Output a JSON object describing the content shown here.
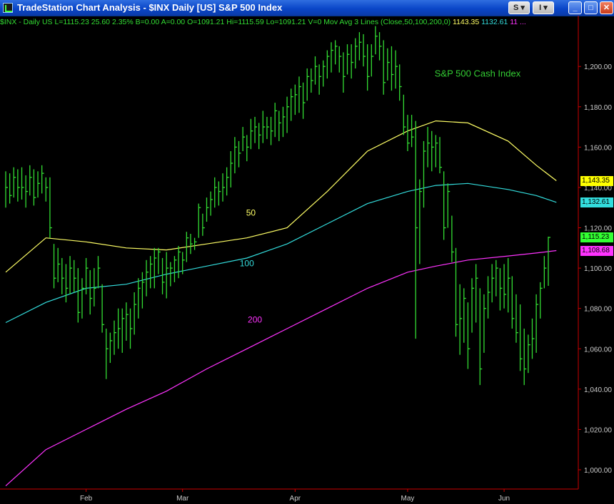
{
  "window": {
    "title": "TradeStation Chart Analysis - $INX Daily [US] S&P 500 Index",
    "buttons": [
      {
        "name": "symbol-link-button",
        "label": "S"
      },
      {
        "name": "interval-link-button",
        "label": "I"
      },
      {
        "name": "minimize-button",
        "label": "_"
      },
      {
        "name": "maximize-button",
        "label": "□"
      },
      {
        "name": "close-button",
        "label": "✕"
      }
    ]
  },
  "status_line": {
    "symbol": "$INX - Daily",
    "exchange": "US",
    "last": "L=1115.23",
    "change": "25.60",
    "change_pct": "2.35%",
    "bid": "B=0.00",
    "ask": "A=0.00",
    "open": "O=1091.21",
    "high": "Hi=1115.59",
    "low": "Lo=1091.21",
    "volume": "V=0",
    "study": "Mov Avg 3 Lines (Close,50,100,200,0)",
    "ma50": "1143.35",
    "ma100": "1132.61",
    "ma200": "11 ..."
  },
  "colors": {
    "background": "#000000",
    "bars": "#33dd33",
    "ma50": "#ffff66",
    "ma100": "#33dddd",
    "ma200": "#ff33ff",
    "axis_text": "#cccccc",
    "axis_line": "#cc0000",
    "title_bar": "#0a46c8"
  },
  "chart_data": {
    "type": "ohlc",
    "title": "S&P 500 Cash Index",
    "ylim": [
      990,
      1222
    ],
    "y_ticks": [
      "1,000.00",
      "1,020.00",
      "1,040.00",
      "1,060.00",
      "1,080.00",
      "1,100.00",
      "1,120.00",
      "1,140.00",
      "1,160.00",
      "1,180.00",
      "1,200.00"
    ],
    "x_months": [
      {
        "label": "Feb",
        "index": 20
      },
      {
        "label": "Mar",
        "index": 44
      },
      {
        "label": "Apr",
        "index": 72
      },
      {
        "label": "May",
        "index": 100
      },
      {
        "label": "Jun",
        "index": 124
      }
    ],
    "bars": [
      {
        "high": 1148,
        "low": 1130,
        "close": 1140
      },
      {
        "high": 1147,
        "low": 1132,
        "close": 1136
      },
      {
        "high": 1150,
        "low": 1135,
        "close": 1145
      },
      {
        "high": 1149,
        "low": 1133,
        "close": 1140
      },
      {
        "high": 1150,
        "low": 1134,
        "close": 1140
      },
      {
        "high": 1146,
        "low": 1130,
        "close": 1138
      },
      {
        "high": 1151,
        "low": 1136,
        "close": 1145
      },
      {
        "high": 1149,
        "low": 1131,
        "close": 1135
      },
      {
        "high": 1148,
        "low": 1135,
        "close": 1142
      },
      {
        "high": 1151,
        "low": 1137,
        "close": 1147
      },
      {
        "high": 1145,
        "low": 1133,
        "close": 1140
      },
      {
        "high": 1145,
        "low": 1115,
        "close": 1120
      },
      {
        "high": 1112,
        "low": 1090,
        "close": 1095
      },
      {
        "high": 1110,
        "low": 1093,
        "close": 1102
      },
      {
        "high": 1105,
        "low": 1087,
        "close": 1095
      },
      {
        "high": 1102,
        "low": 1083,
        "close": 1090
      },
      {
        "high": 1106,
        "low": 1087,
        "close": 1100
      },
      {
        "high": 1104,
        "low": 1088,
        "close": 1095
      },
      {
        "high": 1100,
        "low": 1073,
        "close": 1078
      },
      {
        "high": 1095,
        "low": 1075,
        "close": 1090
      },
      {
        "high": 1105,
        "low": 1087,
        "close": 1100
      },
      {
        "high": 1099,
        "low": 1077,
        "close": 1085
      },
      {
        "high": 1100,
        "low": 1081,
        "close": 1090
      },
      {
        "high": 1106,
        "low": 1090,
        "close": 1100
      },
      {
        "high": 1092,
        "low": 1068,
        "close": 1072
      },
      {
        "high": 1070,
        "low": 1045,
        "close": 1060
      },
      {
        "high": 1068,
        "low": 1053,
        "close": 1064
      },
      {
        "high": 1074,
        "low": 1057,
        "close": 1068
      },
      {
        "high": 1080,
        "low": 1060,
        "close": 1070
      },
      {
        "high": 1080,
        "low": 1058,
        "close": 1075
      },
      {
        "high": 1083,
        "low": 1064,
        "close": 1077
      },
      {
        "high": 1080,
        "low": 1060,
        "close": 1070
      },
      {
        "high": 1088,
        "low": 1067,
        "close": 1082
      },
      {
        "high": 1095,
        "low": 1075,
        "close": 1090
      },
      {
        "high": 1098,
        "low": 1080,
        "close": 1093
      },
      {
        "high": 1104,
        "low": 1086,
        "close": 1098
      },
      {
        "high": 1106,
        "low": 1090,
        "close": 1102
      },
      {
        "high": 1110,
        "low": 1090,
        "close": 1105
      },
      {
        "high": 1110,
        "low": 1097,
        "close": 1108
      },
      {
        "high": 1105,
        "low": 1087,
        "close": 1093
      },
      {
        "high": 1108,
        "low": 1085,
        "close": 1100
      },
      {
        "high": 1103,
        "low": 1091,
        "close": 1100
      },
      {
        "high": 1106,
        "low": 1093,
        "close": 1104
      },
      {
        "high": 1111,
        "low": 1095,
        "close": 1108
      },
      {
        "high": 1108,
        "low": 1097,
        "close": 1104
      },
      {
        "high": 1118,
        "low": 1103,
        "close": 1115
      },
      {
        "high": 1117,
        "low": 1107,
        "close": 1112
      },
      {
        "high": 1115,
        "low": 1109,
        "close": 1113
      },
      {
        "high": 1132,
        "low": 1115,
        "close": 1130
      },
      {
        "high": 1127,
        "low": 1116,
        "close": 1120
      },
      {
        "high": 1135,
        "low": 1123,
        "close": 1130
      },
      {
        "high": 1138,
        "low": 1126,
        "close": 1134
      },
      {
        "high": 1145,
        "low": 1130,
        "close": 1140
      },
      {
        "high": 1143,
        "low": 1131,
        "close": 1138
      },
      {
        "high": 1147,
        "low": 1133,
        "close": 1140
      },
      {
        "high": 1150,
        "low": 1136,
        "close": 1145
      },
      {
        "high": 1158,
        "low": 1140,
        "close": 1152
      },
      {
        "high": 1165,
        "low": 1147,
        "close": 1160
      },
      {
        "high": 1163,
        "low": 1150,
        "close": 1157
      },
      {
        "high": 1170,
        "low": 1158,
        "close": 1165
      },
      {
        "high": 1166,
        "low": 1153,
        "close": 1160
      },
      {
        "high": 1174,
        "low": 1159,
        "close": 1168
      },
      {
        "high": 1175,
        "low": 1162,
        "close": 1170
      },
      {
        "high": 1172,
        "low": 1159,
        "close": 1166
      },
      {
        "high": 1178,
        "low": 1162,
        "close": 1170
      },
      {
        "high": 1175,
        "low": 1164,
        "close": 1170
      },
      {
        "high": 1175,
        "low": 1161,
        "close": 1168
      },
      {
        "high": 1182,
        "low": 1165,
        "close": 1178
      },
      {
        "high": 1178,
        "low": 1163,
        "close": 1172
      },
      {
        "high": 1180,
        "low": 1165,
        "close": 1175
      },
      {
        "high": 1185,
        "low": 1167,
        "close": 1180
      },
      {
        "high": 1189,
        "low": 1173,
        "close": 1185
      },
      {
        "high": 1191,
        "low": 1176,
        "close": 1186
      },
      {
        "high": 1195,
        "low": 1177,
        "close": 1190
      },
      {
        "high": 1192,
        "low": 1174,
        "close": 1182
      },
      {
        "high": 1199,
        "low": 1183,
        "close": 1195
      },
      {
        "high": 1199,
        "low": 1187,
        "close": 1193
      },
      {
        "high": 1205,
        "low": 1191,
        "close": 1200
      },
      {
        "high": 1201,
        "low": 1186,
        "close": 1195
      },
      {
        "high": 1203,
        "low": 1190,
        "close": 1200
      },
      {
        "high": 1208,
        "low": 1194,
        "close": 1205
      },
      {
        "high": 1212,
        "low": 1197,
        "close": 1208
      },
      {
        "high": 1213,
        "low": 1201,
        "close": 1210
      },
      {
        "high": 1210,
        "low": 1197,
        "close": 1205
      },
      {
        "high": 1207,
        "low": 1187,
        "close": 1195
      },
      {
        "high": 1211,
        "low": 1196,
        "close": 1206
      },
      {
        "high": 1211,
        "low": 1194,
        "close": 1202
      },
      {
        "high": 1214,
        "low": 1199,
        "close": 1210
      },
      {
        "high": 1217,
        "low": 1203,
        "close": 1212
      },
      {
        "high": 1216,
        "low": 1200,
        "close": 1205
      },
      {
        "high": 1211,
        "low": 1188,
        "close": 1195
      },
      {
        "high": 1211,
        "low": 1195,
        "close": 1205
      },
      {
        "high": 1220,
        "low": 1206,
        "close": 1215
      },
      {
        "high": 1217,
        "low": 1203,
        "close": 1210
      },
      {
        "high": 1213,
        "low": 1186,
        "close": 1192
      },
      {
        "high": 1209,
        "low": 1193,
        "close": 1202
      },
      {
        "high": 1210,
        "low": 1188,
        "close": 1196
      },
      {
        "high": 1208,
        "low": 1189,
        "close": 1200
      },
      {
        "high": 1201,
        "low": 1183,
        "close": 1190
      },
      {
        "high": 1186,
        "low": 1166,
        "close": 1170
      },
      {
        "high": 1176,
        "low": 1158,
        "close": 1162
      },
      {
        "high": 1176,
        "low": 1160,
        "close": 1165
      },
      {
        "high": 1173,
        "low": 1065,
        "close": 1120
      },
      {
        "high": 1144,
        "low": 1102,
        "close": 1138
      },
      {
        "high": 1163,
        "low": 1130,
        "close": 1158
      },
      {
        "high": 1170,
        "low": 1150,
        "close": 1162
      },
      {
        "high": 1168,
        "low": 1148,
        "close": 1160
      },
      {
        "high": 1166,
        "low": 1150,
        "close": 1162
      },
      {
        "high": 1165,
        "low": 1147,
        "close": 1150
      },
      {
        "high": 1148,
        "low": 1114,
        "close": 1120
      },
      {
        "high": 1142,
        "low": 1120,
        "close": 1138
      },
      {
        "high": 1126,
        "low": 1103,
        "close": 1108
      },
      {
        "high": 1110,
        "low": 1066,
        "close": 1072
      },
      {
        "high": 1092,
        "low": 1057,
        "close": 1075
      },
      {
        "high": 1090,
        "low": 1063,
        "close": 1085
      },
      {
        "high": 1083,
        "low": 1050,
        "close": 1060
      },
      {
        "high": 1095,
        "low": 1068,
        "close": 1090
      },
      {
        "high": 1102,
        "low": 1073,
        "close": 1095
      },
      {
        "high": 1090,
        "low": 1042,
        "close": 1050
      },
      {
        "high": 1087,
        "low": 1058,
        "close": 1080
      },
      {
        "high": 1096,
        "low": 1075,
        "close": 1088
      },
      {
        "high": 1102,
        "low": 1083,
        "close": 1095
      },
      {
        "high": 1104,
        "low": 1086,
        "close": 1100
      },
      {
        "high": 1100,
        "low": 1079,
        "close": 1090
      },
      {
        "high": 1102,
        "low": 1080,
        "close": 1087
      },
      {
        "high": 1105,
        "low": 1078,
        "close": 1095
      },
      {
        "high": 1096,
        "low": 1070,
        "close": 1075
      },
      {
        "high": 1087,
        "low": 1063,
        "close": 1068
      },
      {
        "high": 1082,
        "low": 1049,
        "close": 1055
      },
      {
        "high": 1070,
        "low": 1042,
        "close": 1050
      },
      {
        "high": 1067,
        "low": 1048,
        "close": 1062
      },
      {
        "high": 1075,
        "low": 1055,
        "close": 1065
      },
      {
        "high": 1087,
        "low": 1058,
        "close": 1082
      },
      {
        "high": 1093,
        "low": 1075,
        "close": 1090
      },
      {
        "high": 1106,
        "low": 1090,
        "close": 1100
      },
      {
        "high": 1115.59,
        "low": 1091.21,
        "close": 1115.23
      }
    ],
    "series": [
      {
        "name": "50",
        "color": "#ffff66",
        "x": [
          0,
          10,
          20,
          30,
          40,
          50,
          60,
          70,
          80,
          90,
          100,
          107,
          115,
          125,
          132,
          137
        ],
        "values": [
          1098,
          1115,
          1113,
          1110,
          1109,
          1112,
          1115,
          1120,
          1138,
          1158,
          1168,
          1173,
          1172,
          1163,
          1151,
          1143.35
        ]
      },
      {
        "name": "100",
        "color": "#33dddd",
        "x": [
          0,
          10,
          20,
          30,
          40,
          50,
          60,
          70,
          80,
          90,
          100,
          107,
          115,
          125,
          132,
          137
        ],
        "values": [
          1073,
          1083,
          1090,
          1092,
          1097,
          1101,
          1105,
          1112,
          1122,
          1132,
          1138,
          1141,
          1142,
          1139,
          1136,
          1132.61
        ]
      },
      {
        "name": "200",
        "color": "#ff33ff",
        "x": [
          0,
          10,
          20,
          30,
          40,
          50,
          60,
          70,
          80,
          90,
          100,
          107,
          115,
          125,
          132,
          137
        ],
        "values": [
          992,
          1010,
          1020,
          1030,
          1039,
          1050,
          1060,
          1070,
          1080,
          1090,
          1098,
          1101,
          1104,
          1106,
          1107.5,
          1108.68
        ]
      }
    ],
    "series_labels": [
      {
        "text": "50",
        "color": "#ffff66",
        "x": 61,
        "y": 1126
      },
      {
        "text": "100",
        "color": "#33dddd",
        "x": 60,
        "y": 1101
      },
      {
        "text": "200",
        "color": "#ff33ff",
        "x": 62,
        "y": 1073
      }
    ],
    "price_labels": [
      {
        "text": "1,143.35",
        "value": 1143.35,
        "bg": "#ffff00"
      },
      {
        "text": "1,132.61",
        "value": 1132.61,
        "bg": "#33dddd"
      },
      {
        "text": "1,115.23",
        "value": 1115.23,
        "bg": "#33ff33"
      },
      {
        "text": "1,108.68",
        "value": 1108.68,
        "bg": "#ff33ff"
      }
    ]
  }
}
